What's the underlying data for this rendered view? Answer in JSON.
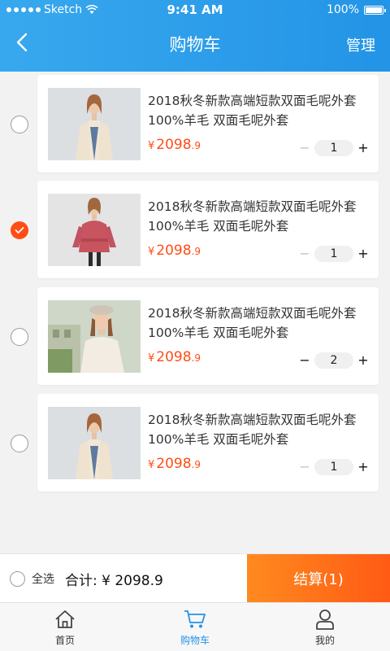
{
  "status": {
    "carrier": "Sketch",
    "time": "9:41 AM",
    "battery": "100%"
  },
  "header": {
    "title": "购物车",
    "manage": "管理"
  },
  "items": [
    {
      "title": "2018秋冬新款高端短款双面毛呢外套100%羊毛 双面毛呢外套",
      "currency": "¥",
      "price_int": "2098",
      "price_dec": ".9",
      "qty": "1",
      "selected": false,
      "minus_enabled": false,
      "icon": "coat-cream"
    },
    {
      "title": "2018秋冬新款高端短款双面毛呢外套100%羊毛 双面毛呢外套",
      "currency": "¥",
      "price_int": "2098",
      "price_dec": ".9",
      "qty": "1",
      "selected": true,
      "minus_enabled": false,
      "icon": "coat-pink"
    },
    {
      "title": "2018秋冬新款高端短款双面毛呢外套100%羊毛 双面毛呢外套",
      "currency": "¥",
      "price_int": "2098",
      "price_dec": ".9",
      "qty": "2",
      "selected": false,
      "minus_enabled": true,
      "icon": "coat-beret"
    },
    {
      "title": "2018秋冬新款高端短款双面毛呢外套100%羊毛 双面毛呢外套",
      "currency": "¥",
      "price_int": "2098",
      "price_dec": ".9",
      "qty": "1",
      "selected": false,
      "minus_enabled": false,
      "icon": "coat-cream"
    }
  ],
  "qty_minus": "−",
  "qty_plus": "+",
  "checkout": {
    "select_all": "全选",
    "total": "合计: ¥ 2098.9",
    "settle": "结算(1)"
  },
  "tabs": [
    {
      "label": "首页",
      "icon": "home-icon",
      "active": false
    },
    {
      "label": "购物车",
      "icon": "cart-icon",
      "active": true
    },
    {
      "label": "我的",
      "icon": "user-icon",
      "active": false
    }
  ],
  "colors": {
    "primary": "#2394e6",
    "accent": "#ff4d16",
    "checkout_gradient_start": "#ff8a1f",
    "checkout_gradient_end": "#ff5a14"
  }
}
